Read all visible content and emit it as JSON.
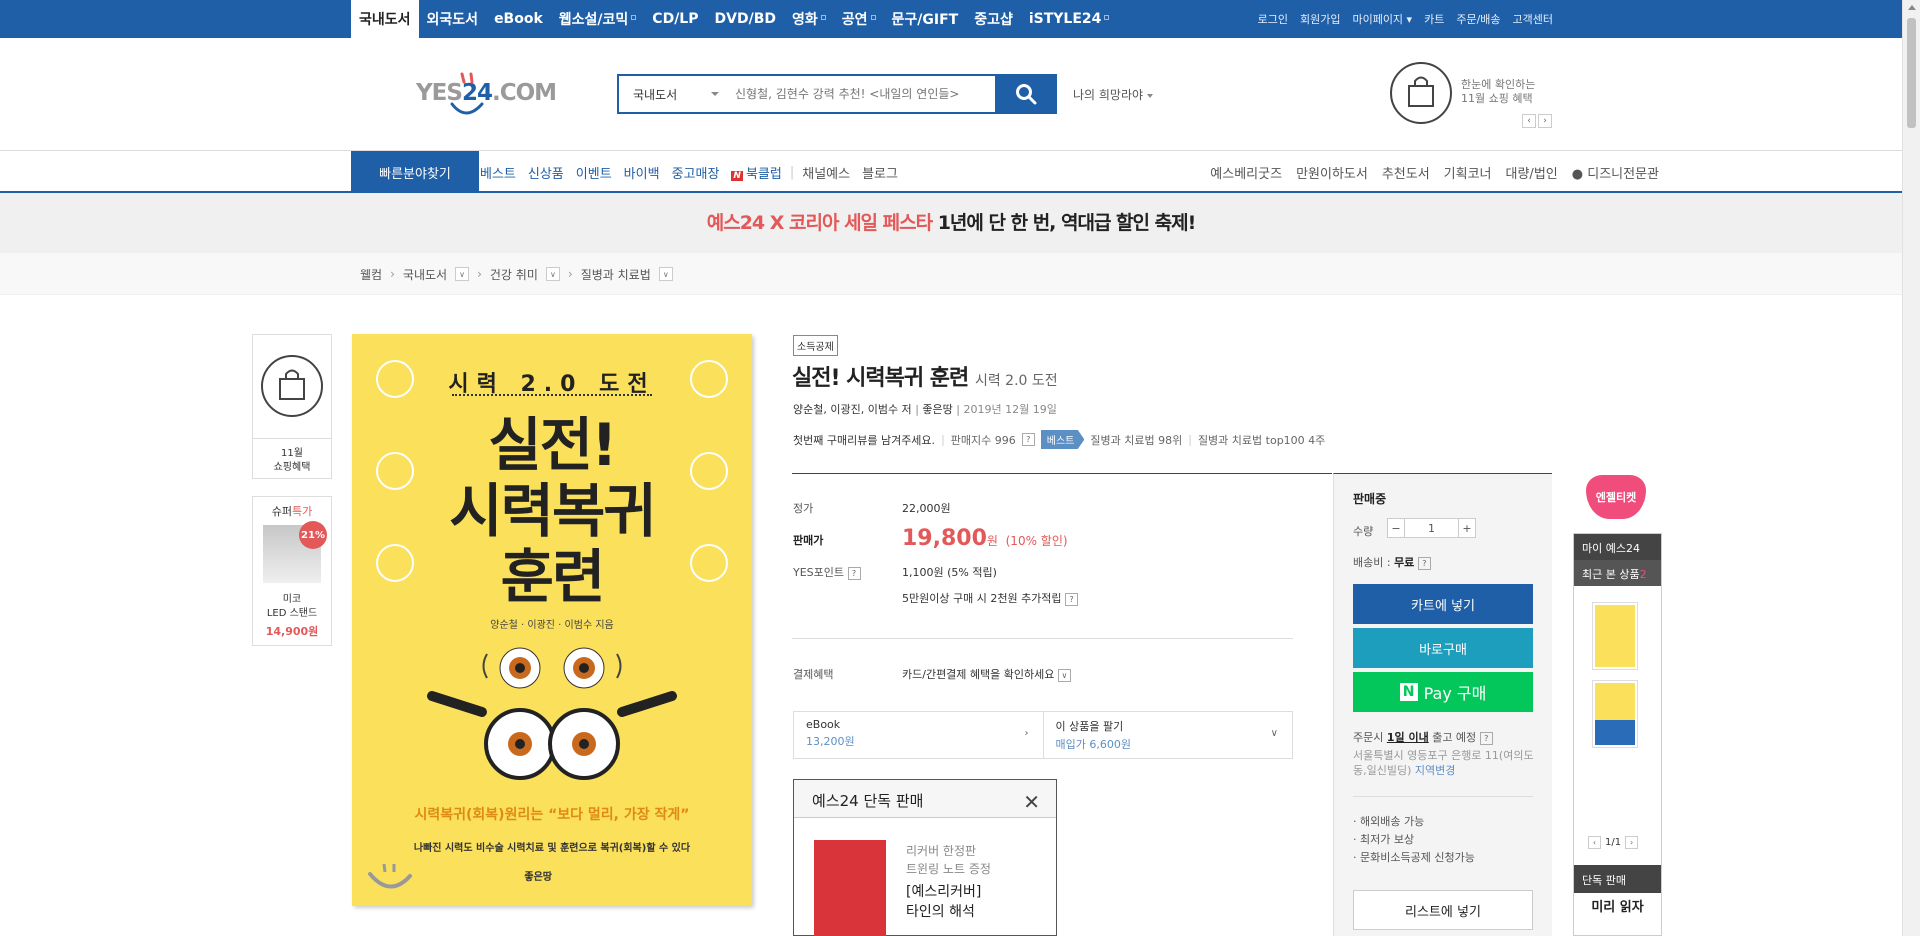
{
  "top_tabs": [
    {
      "label": "국내도서",
      "active": true
    },
    {
      "label": "외국도서"
    },
    {
      "label": "eBook"
    },
    {
      "label": "웹소설/코믹"
    },
    {
      "label": "CD/LP"
    },
    {
      "label": "DVD/BD"
    },
    {
      "label": "영화"
    },
    {
      "label": "공연"
    },
    {
      "label": "문구/GIFT"
    },
    {
      "label": "중고샵"
    },
    {
      "label": "iSTYLE24"
    }
  ],
  "top_links": [
    "로그인",
    "회원가입",
    "마이페이지 ▾",
    "카트",
    "주문/배송",
    "고객센터"
  ],
  "logo": {
    "prefix": "YES",
    "num": "24",
    "suffix": ".COM"
  },
  "search": {
    "category": "국내도서",
    "placeholder": "신형철, 김현수 강력 추천! <내일의 연인들>"
  },
  "my_hope": "나의 희망라야",
  "shopping": {
    "line1": "한눈에 확인하는",
    "line2": "11월 쇼핑 혜택"
  },
  "nav": {
    "quick": "빠른분야찾기",
    "left": [
      "베스트",
      "신상품",
      "이벤트",
      "바이백",
      "중고매장",
      "북클럽",
      "채널예스",
      "블로그"
    ],
    "right": [
      "예스베리굿즈",
      "만원이하도서",
      "추천도서",
      "기획코너",
      "대량/법인",
      "디즈니전문관"
    ]
  },
  "promo": {
    "highlight": "예스24 X 코리아 세일 페스타",
    "rest": " 1년에 단 한 번, 역대급 할인 축제!"
  },
  "breadcrumb": [
    "웰컴",
    "국내도서",
    "건강 취미",
    "질병과 치료법"
  ],
  "left_float": {
    "shop_label": "11월\n쇼핑혜택",
    "deal_title": "슈퍼",
    "deal_title_red": "특가",
    "deal_pct": "21%",
    "deal_name": "미코\nLED 스탠드",
    "deal_price": "14,900원"
  },
  "cover": {
    "sub": "시력 2.0 도전",
    "title": "실전!\n시력복귀\n훈련",
    "authors": "양순철 · 이광진 · 이범수 지음",
    "tagline": "시력복귀(회복)원리는 “보다 멀리, 가장 작게”",
    "tagline2": "나빠진 시력도 비수술 시력치료 및 훈련으로 복귀(회복)할 수 있다",
    "publisher": "좋은땅"
  },
  "product": {
    "badge": "소득공제",
    "title": "실전! 시력복귀 훈련",
    "subtitle": "시력 2.0 도전",
    "authors": "양순철, 이광진, 이범수 저",
    "publisher": "좋은땅",
    "date": "2019년 12월 19일",
    "review_prompt": "첫번째 구매리뷰를 남겨주세요.",
    "sales_index": "판매지수 996",
    "best_label": "베스트",
    "rank1": "질병과 치료법 98위",
    "rank2": "질병과 치료법 top100 4주",
    "list_price_label": "정가",
    "list_price": "22,000원",
    "sale_label": "판매가",
    "sale_price": "19,800",
    "sale_unit": "원",
    "discount": "(10% 할인)",
    "point_label": "YES포인트",
    "point": "1,100원 (5% 적립)",
    "point_extra": "5만원이상 구매 시 2천원 추가적립",
    "payment_label": "결제혜택",
    "payment_value": "카드/간편결제 혜택을 확인하세요",
    "ebook_label": "eBook",
    "ebook_price": "13,200원",
    "sell_label": "이 상품을 팔기",
    "sell_price": "매입가 6,600원"
  },
  "exclusive": {
    "title": "예스24 단독 판매",
    "line1": "리커버 한정판",
    "line2": "트윈링 노트 증정",
    "book1": "[예스리커버]",
    "book2": "타인의 해석"
  },
  "buy": {
    "status": "판매중",
    "qty_label": "수량",
    "qty": "1",
    "ship_label": "배송비 :",
    "ship_value": "무료",
    "cart": "카트에 넣기",
    "buy_now": "바로구매",
    "npay": "Pay 구매",
    "order_prefix": "주문시 ",
    "order_bold": "1일 이내",
    "order_suffix": " 출고 예정",
    "address": "서울특별시 영등포구 은행로 11(여의도동,일신빌딩)",
    "address_change": "지역변경",
    "features": [
      "· 해외배송 가능",
      "· 최저가 보상",
      "· 문화비소득공제 신청가능"
    ],
    "wishlist": "리스트에 넣기"
  },
  "rail": {
    "angel": "엔젤티켓",
    "my": "마이 예스24",
    "recent": "최근 본 상품",
    "recent_count": "2",
    "page": "1/1",
    "exclusive": "단독 판매",
    "preview": "미리 읽자"
  },
  "colors": {
    "brand": "#1f5fa8",
    "red": "#e35858",
    "npay": "#03c75a",
    "teal": "#1d9ebd"
  }
}
